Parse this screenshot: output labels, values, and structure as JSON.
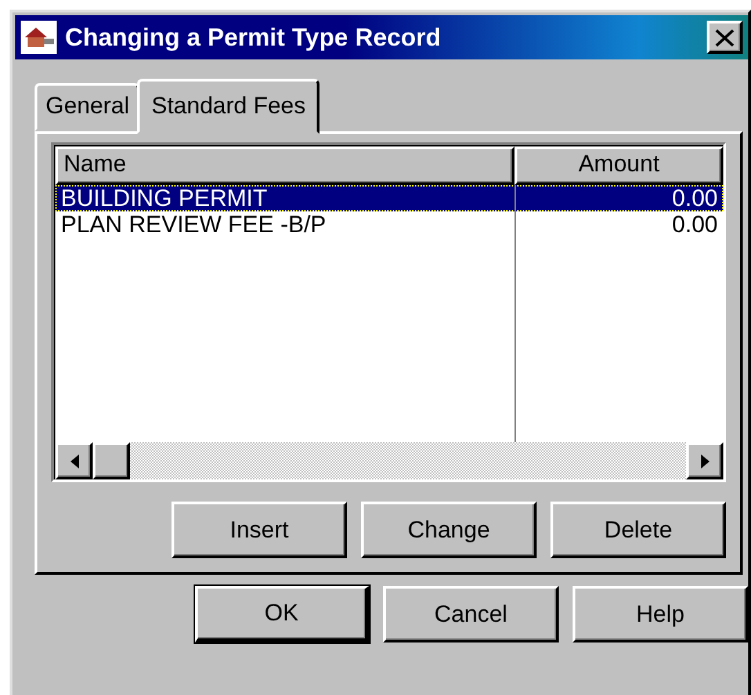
{
  "window": {
    "title": "Changing a Permit Type Record"
  },
  "tabs": [
    {
      "label": "General",
      "selected": false
    },
    {
      "label": "Standard Fees",
      "selected": true
    }
  ],
  "table": {
    "columns": [
      "Name",
      "Amount"
    ],
    "rows": [
      {
        "cells": [
          "BUILDING PERMIT",
          "0.00"
        ],
        "selected": true
      },
      {
        "cells": [
          "PLAN REVIEW FEE -B/P",
          "0.00"
        ],
        "selected": false
      }
    ]
  },
  "list_buttons": [
    "Insert",
    "Change",
    "Delete"
  ],
  "dialog_buttons": [
    {
      "label": "OK",
      "default": true
    },
    {
      "label": "Cancel",
      "default": false
    },
    {
      "label": "Help",
      "default": false
    }
  ]
}
